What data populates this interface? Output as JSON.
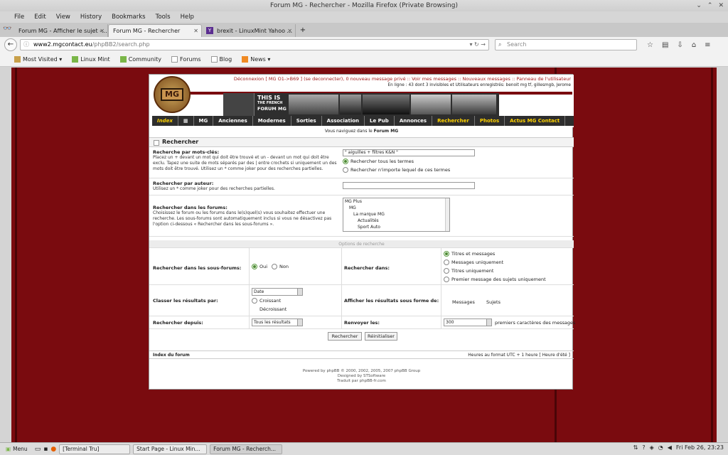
{
  "window": {
    "title": "Forum MG - Rechercher - Mozilla Firefox (Private Browsing)"
  },
  "menu": [
    "File",
    "Edit",
    "View",
    "History",
    "Bookmarks",
    "Tools",
    "Help"
  ],
  "tabs": [
    {
      "label": "Forum MG - Afficher le sujet -..."
    },
    {
      "label": "Forum MG - Rechercher"
    },
    {
      "label": "brexit - LinuxMint Yahoo ..."
    }
  ],
  "url": {
    "host": "www2.mgcontact.eu",
    "path": "/phpBB2/search.php"
  },
  "search_placeholder": "Search",
  "bookmarks": [
    "Most Visited ▾",
    "Linux Mint",
    "Community",
    "Forums",
    "Blog",
    "News ▾"
  ],
  "forum": {
    "top_line1": "Déconnexion [ MG O1->B69 ] (se deconnecter), 0 nouveau message privé :: Voir mes messages :: Nouveaux messages :: Panneau de l'utilisateur",
    "top_line2": "En ligne : 43 dont 3 invisibles et Utilisateurs enregistrés: benoit mg tf, gillesmgb, Jerome",
    "banner_this": "THIS IS",
    "banner_the": "THE FRENCH",
    "banner_forum": "FORUM MG",
    "nav": [
      "Index",
      "MG",
      "Anciennes",
      "Modernes",
      "Sorties",
      "Association",
      "Le Pub",
      "Annonces",
      "Rechercher",
      "Photos",
      "Actus MG Contact"
    ],
    "breadcrumb": "Vous naviguez dans le",
    "breadcrumb_forum": "Forum MG",
    "section_title": "Rechercher",
    "kw_label": "Recherche par mots-clés:",
    "kw_desc": "Placez un + devant un mot qui doit être trouvé et un - devant un mot qui doit être exclu. Tapez une suite de mots séparés par des | entre crochets si uniquement un des mots doit être trouvé. Utilisez un * comme joker pour des recherches partielles.",
    "kw_value": "\" aiguilles + filtres K&N \"",
    "kw_opt1": "Rechercher tous les termes",
    "kw_opt2": "Rechercher n'importe lequel de ces termes",
    "author_label": "Rechercher par auteur:",
    "author_desc": "Utilisez un * comme joker pour des recherches partielles.",
    "forums_label": "Rechercher dans les forums:",
    "forums_desc": "Choisissez le forum ou les forums dans le(s)quel(s) vous souhaitez effectuer une recherche. Les sous-forums sont automatiquement inclus si vous ne désactivez pas l'option ci-dessous « Rechercher dans les sous-forums ».",
    "forum_list": [
      "MG Plus",
      "MG",
      "La marque MG",
      "Actualités",
      "Sport Auto"
    ],
    "options_title": "Options de recherche",
    "subforums_label": "Rechercher dans les sous-forums:",
    "oui": "Oui",
    "non": "Non",
    "search_in_label": "Rechercher dans:",
    "search_in_opts": [
      "Titres et messages",
      "Messages uniquement",
      "Titres uniquement",
      "Premier message des sujets uniquement"
    ],
    "sort_label": "Classer les résultats par:",
    "sort_value": "Date",
    "sort_opt1": "Croissant",
    "sort_opt2": "Décroissant",
    "display_label": "Afficher les résultats sous forme de:",
    "display_opt1": "Messages",
    "display_opt2": "Sujets",
    "since_label": "Rechercher depuis:",
    "since_value": "Tous les résultats",
    "return_label": "Renvoyer les:",
    "return_value": "300",
    "return_suffix": "premiers caractères des messages",
    "btn_search": "Rechercher",
    "btn_reset": "Réinitialiser",
    "footer_left": "Index du forum",
    "footer_right": "Heures au format UTC + 1 heure [ Heure d'été ]",
    "powered1": "Powered by phpBB © 2000, 2002, 2005, 2007 phpBB Group",
    "powered2": "Designed by STSoftware",
    "powered3": "Traduit par phpBB-fr.com"
  },
  "taskbar": {
    "menu": "Menu",
    "items": [
      "[Terminal Tru]",
      "Start Page - Linux Min...",
      "Forum MG - Recherch..."
    ],
    "clock": "Fri Feb 26, 23:23"
  }
}
